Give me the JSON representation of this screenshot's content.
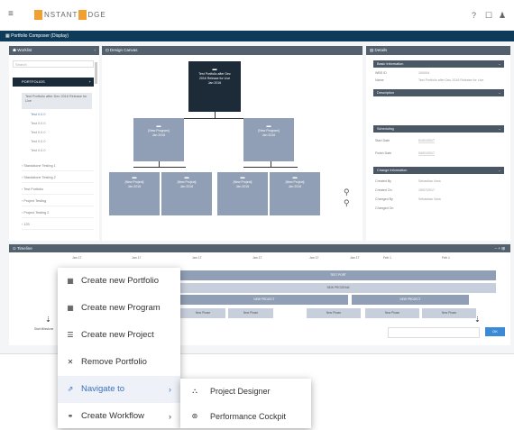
{
  "app": {
    "logo_pre": "NSTANT",
    "logo_post": "DGE",
    "header_title": "Portfolio Composer (Display)",
    "top_right": {
      "help": "?",
      "chat": "☐",
      "user": "♟"
    }
  },
  "worklist": {
    "title": "Worklist",
    "search_placeholder": "Search",
    "portfolio_header": "PORTFOLIOS",
    "selected_item": "Test Portfolio after Dec 2016 Release for Live",
    "sub_items": [
      "Test 0.0.0",
      "Test 0.0.0",
      "Test 0.0.0",
      "Test 0.0.0",
      "Test 0.0.0"
    ],
    "items": [
      "Standalone Testing 1",
      "Standalone Testing 2",
      "Test Portfolio",
      "Project Testing",
      "Project Testing 2",
      "123"
    ]
  },
  "canvas": {
    "title": "Design Canvas",
    "root": {
      "line1": "Test Portfolio after Dec",
      "line2": "2016 Release for Live",
      "line3": "Jan 2016"
    },
    "level1": [
      {
        "title": "[New Program]",
        "sub": "Jan 2016"
      },
      {
        "title": "[New Program]",
        "sub": "Jan 2016"
      }
    ],
    "level2": [
      {
        "title": "[New Project]",
        "sub": "Jan 2016"
      },
      {
        "title": "[New Project]",
        "sub": "Jan 2016"
      },
      {
        "title": "[New Project]",
        "sub": "Jan 2016"
      },
      {
        "title": "[New Project]",
        "sub": "Jan 2016"
      }
    ]
  },
  "details": {
    "title": "Details",
    "basic_header": "Basic Information",
    "basic": [
      {
        "k": "WBS ID",
        "v": "100004"
      },
      {
        "k": "Name",
        "v": "Test Portfolio after Dec 2016 Release for Live"
      }
    ],
    "description_header": "Description",
    "scheduling_header": "Scheduling",
    "scheduling": [
      {
        "k": "Start Date",
        "v": "01/01/2017"
      },
      {
        "k": "Finish Date",
        "v": "04/01/2017"
      }
    ],
    "change_header": "Change Information",
    "change": [
      {
        "k": "Created By",
        "v": "Sebastian Voss"
      },
      {
        "k": "Created On",
        "v": "15/07/2017"
      },
      {
        "k": "Changed By",
        "v": "Sebastian Voss"
      },
      {
        "k": "Changed On",
        "v": ""
      }
    ]
  },
  "timeline": {
    "title": "Timeline",
    "months": [
      "Jan 17",
      "Jan 17",
      "Jan 17",
      "Jan 17",
      "Jan 17",
      "Jan 17",
      "Feb 1",
      "Feb 1"
    ],
    "rows": {
      "r1": "TEST PORT",
      "r2": "NEW PROGRAM",
      "r3a": "NEW PROJECT",
      "r3b": "NEW PROJECT"
    },
    "phases": [
      "New Phase",
      "New Phase",
      "New Phase",
      "New Phase",
      "New Phase"
    ],
    "milestone_left": "Start Milestone",
    "ok_label": "OK"
  },
  "context_menu": {
    "items": [
      {
        "icon": "▦",
        "label": "Create new Portfolio"
      },
      {
        "icon": "▦",
        "label": "Create new Program"
      },
      {
        "icon": "☰",
        "label": "Create new Project"
      },
      {
        "icon": "✕",
        "label": "Remove Portfolio"
      },
      {
        "icon": "⇗",
        "label": "Navigate to",
        "arrow": "›"
      },
      {
        "icon": "⚭",
        "label": "Create Workflow",
        "arrow": "›"
      }
    ]
  },
  "submenu": {
    "items": [
      {
        "icon": "⛬",
        "label": "Project Designer"
      },
      {
        "icon": "⊛",
        "label": "Performance Cockpit"
      }
    ]
  }
}
